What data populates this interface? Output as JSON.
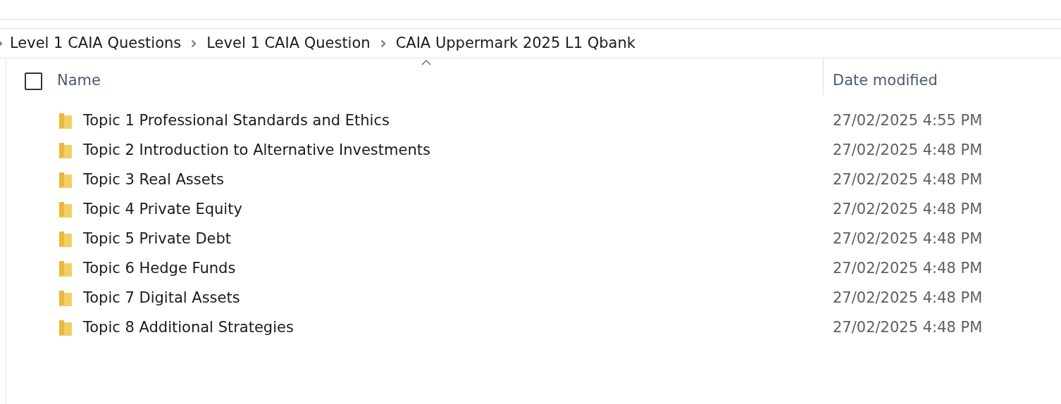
{
  "breadcrumb": [
    "Level 1 CAIA Questions",
    "Level 1 CAIA Question",
    "CAIA Uppermark 2025 L1 Qbank"
  ],
  "header": {
    "select_all": {
      "checked": false
    },
    "columns": [
      {
        "label": "Name",
        "sorted": true
      },
      {
        "label": "Date modified",
        "sorted": false
      }
    ]
  },
  "rows": [
    {
      "name": "Topic 1 Professional Standards and Ethics",
      "date_modified": "27/02/2025 4:55 PM"
    },
    {
      "name": "Topic 2 Introduction to Alternative Investments",
      "date_modified": "27/02/2025 4:48 PM"
    },
    {
      "name": "Topic 3 Real Assets",
      "date_modified": "27/02/2025 4:48 PM"
    },
    {
      "name": "Topic 4 Private Equity",
      "date_modified": "27/02/2025 4:48 PM"
    },
    {
      "name": "Topic 5 Private Debt",
      "date_modified": "27/02/2025 4:48 PM"
    },
    {
      "name": "Topic 6 Hedge Funds",
      "date_modified": "27/02/2025 4:48 PM"
    },
    {
      "name": "Topic 7 Digital Assets",
      "date_modified": "27/02/2025 4:48 PM"
    },
    {
      "name": "Topic 8 Additional Strategies",
      "date_modified": "27/02/2025 4:48 PM"
    }
  ]
}
